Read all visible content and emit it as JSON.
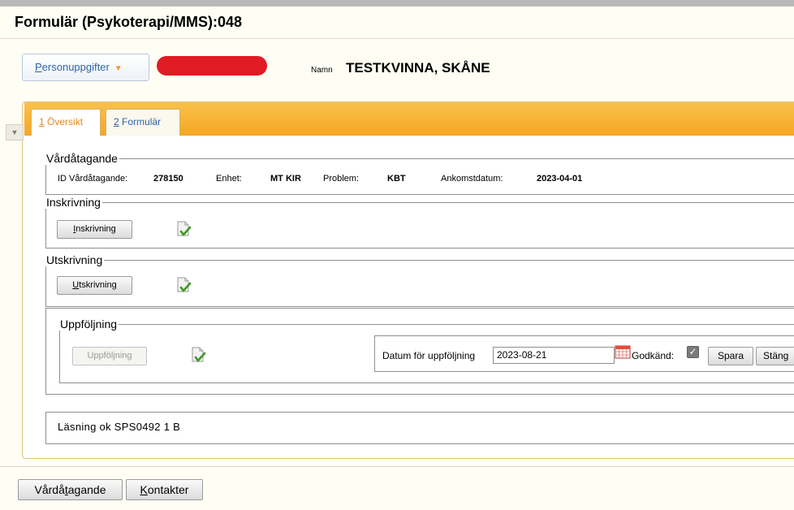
{
  "page_title": "Formulär (Psykoterapi/MMS):048",
  "header": {
    "personuppgifter_label": "Personuppgifter",
    "namn_label": "Namn",
    "namn_value": "TESTKVINNA, SKÅNE"
  },
  "tabs": [
    {
      "label": "Översikt",
      "key": "1",
      "active": true
    },
    {
      "label": "Formulär",
      "key": "2",
      "active": false
    }
  ],
  "vardatagande": {
    "legend": "Vårdåtagande",
    "id_label": "ID Vårdåtagande:",
    "id_value": "278150",
    "enhet_label": "Enhet:",
    "enhet_value": "MT KIR",
    "problem_label": "Problem:",
    "problem_value": "KBT",
    "ankomst_label": "Ankomstdatum:",
    "ankomst_value": "2023-04-01"
  },
  "inskrivning": {
    "legend": "Inskrivning",
    "button": "Inskrivning"
  },
  "utskrivning": {
    "legend": "Utskrivning",
    "button": "Utskrivning"
  },
  "uppfoljning": {
    "legend": "Uppföljning",
    "button": "Uppföljning",
    "datum_label": "Datum för uppföljning",
    "datum_value": "2023-08-21",
    "godkand_label": "Godkänd:",
    "godkand_checked": true,
    "spara_label": "Spara",
    "stang_label": "Stäng"
  },
  "status_message": "Läsning ok SPS0492 1 B",
  "footer": {
    "vardatagande_button": "Vårdåtagande",
    "kontakter_button": "Kontakter"
  },
  "colors": {
    "tab_bar": "#f5a623",
    "active_tab_text": "#e7891b",
    "link_blue": "#2f64a6",
    "redaction": "#e01b24"
  }
}
